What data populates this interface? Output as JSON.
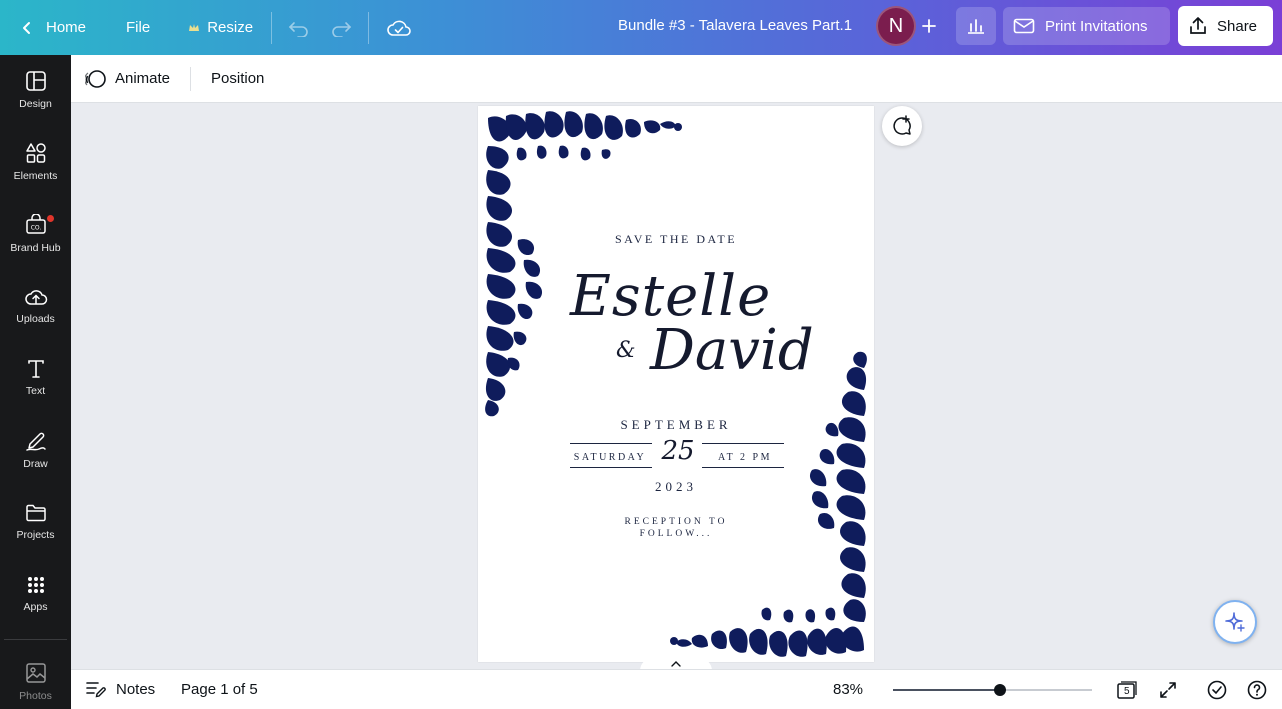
{
  "topbar": {
    "home_label": "Home",
    "file_label": "File",
    "resize_label": "Resize",
    "doc_title": "Bundle #3 - Talavera Leaves Part.1",
    "avatar_initial": "N",
    "print_label": "Print Invitations",
    "share_label": "Share"
  },
  "sidebar": {
    "items": [
      {
        "label": "Design",
        "icon": "layout-icon"
      },
      {
        "label": "Elements",
        "icon": "shapes-icon"
      },
      {
        "label": "Brand Hub",
        "icon": "brand-icon"
      },
      {
        "label": "Uploads",
        "icon": "cloud-upload-icon"
      },
      {
        "label": "Text",
        "icon": "text-icon"
      },
      {
        "label": "Draw",
        "icon": "draw-icon"
      },
      {
        "label": "Projects",
        "icon": "folder-icon"
      },
      {
        "label": "Apps",
        "icon": "apps-icon"
      },
      {
        "label": "Photos",
        "icon": "image-icon"
      }
    ]
  },
  "context_toolbar": {
    "animate_label": "Animate",
    "position_label": "Position"
  },
  "invitation": {
    "save_the_date": "SAVE THE DATE",
    "name1": "Estelle",
    "ampersand": "&",
    "name2": "David",
    "month": "SEPTEMBER",
    "weekday": "SATURDAY",
    "day": "25",
    "time": "AT 2 PM",
    "year": "2023",
    "reception": "RECEPTION TO FOLLOW..."
  },
  "bottombar": {
    "notes_label": "Notes",
    "page_indicator": "Page 1 of 5",
    "zoom_label": "83%",
    "zoom_fraction": 0.54,
    "page_count": "5"
  },
  "colors": {
    "topbar_gradient_start": "#2bb6c9",
    "topbar_gradient_end": "#7a3fd6",
    "leaf_navy": "#0f1c5c",
    "sidebar_bg": "#18191b",
    "avatar_bg": "#7b1d4e"
  }
}
